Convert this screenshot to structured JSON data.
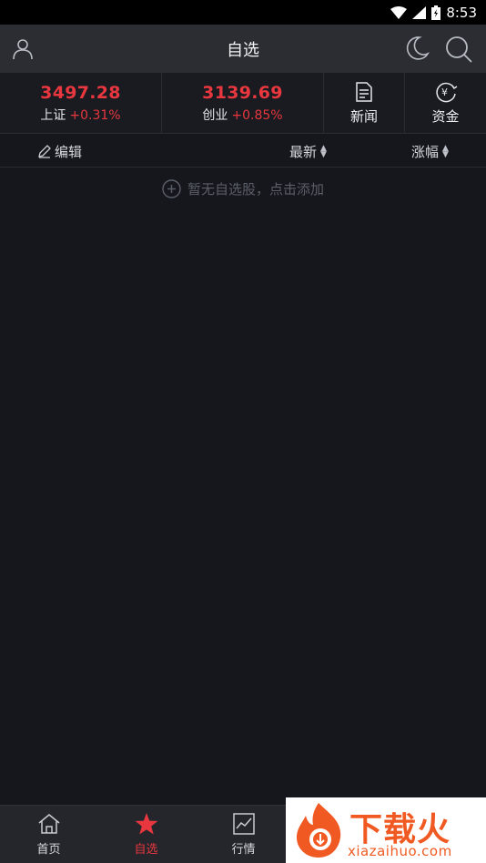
{
  "statusbar": {
    "time": "8:53"
  },
  "header": {
    "title": "自选"
  },
  "indices": [
    {
      "value": "3497.28",
      "name": "上证",
      "change": "+0.31%"
    },
    {
      "value": "3139.69",
      "name": "创业",
      "change": "+0.85%"
    }
  ],
  "shortcuts": [
    {
      "label": "新闻",
      "icon": "news-icon"
    },
    {
      "label": "资金",
      "icon": "funds-icon"
    }
  ],
  "list_header": {
    "edit": "编辑",
    "latest": "最新",
    "change": "涨幅"
  },
  "empty_hint": "暂无自选股，点击添加",
  "bottom_nav": {
    "items": [
      {
        "label": "首页",
        "icon": "home-icon",
        "active": false
      },
      {
        "label": "自选",
        "icon": "star-icon",
        "active": true
      },
      {
        "label": "行情",
        "icon": "chart-icon",
        "active": false
      }
    ]
  },
  "watermark": {
    "brand": "下载火",
    "url": "xiazaihuo.com"
  },
  "colors": {
    "up": "#e8373e",
    "background": "#15171d",
    "titlebar": "#2b2d33"
  }
}
